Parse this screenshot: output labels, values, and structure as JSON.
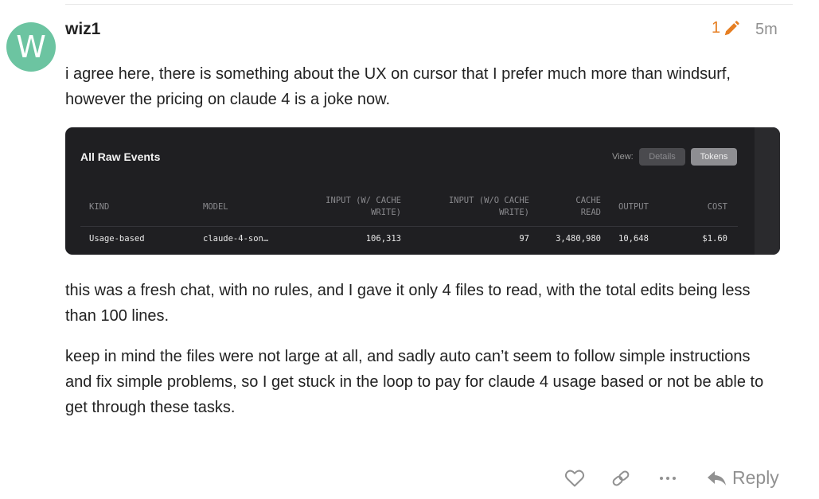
{
  "post": {
    "avatar_letter": "W",
    "username": "wiz1",
    "edit_count": "1",
    "date": "5m",
    "paragraphs": [
      "i agree here, there is something about the UX on cursor that I prefer much more than windsurf, however the pricing on claude 4 is a joke now.",
      "this was a fresh chat, with no rules, and I gave it only 4 files to read, with the total edits being less than 100 lines.",
      "keep in mind the files were not large at all, and sadly auto can’t seem to follow simple instructions and fix simple problems, so I get stuck in the loop to pay for claude 4 usage based or not be able to get through these tasks."
    ]
  },
  "embed": {
    "title": "All Raw Events",
    "view_label": "View:",
    "view_options": [
      "Details",
      "Tokens"
    ],
    "selected_view": "Tokens",
    "columns": {
      "kind": "KIND",
      "model": "MODEL",
      "input_w_cache_1": "INPUT (W/ CACHE",
      "input_w_cache_2": "WRITE)",
      "input_wo_cache_1": "INPUT (W/O CACHE",
      "input_wo_cache_2": "WRITE)",
      "cache_read_1": "CACHE",
      "cache_read_2": "READ",
      "output": "OUTPUT",
      "cost": "COST"
    },
    "row": {
      "kind": "Usage-based",
      "model": "claude-4-son…",
      "input_w_cache": "106,313",
      "input_wo_cache": "97",
      "cache_read": "3,480,980",
      "output": "10,648",
      "cost": "$1.60"
    }
  },
  "actions": {
    "reply_label": "Reply",
    "more_icon": "ellipsis-icon",
    "like_icon": "heart-icon",
    "link_icon": "link-icon",
    "reply_icon": "reply-arrow-icon"
  },
  "colors": {
    "avatar": "#6cc4a1",
    "edit_accent": "#e67e22",
    "muted": "#919191",
    "embed_bg": "#1f1f22"
  }
}
